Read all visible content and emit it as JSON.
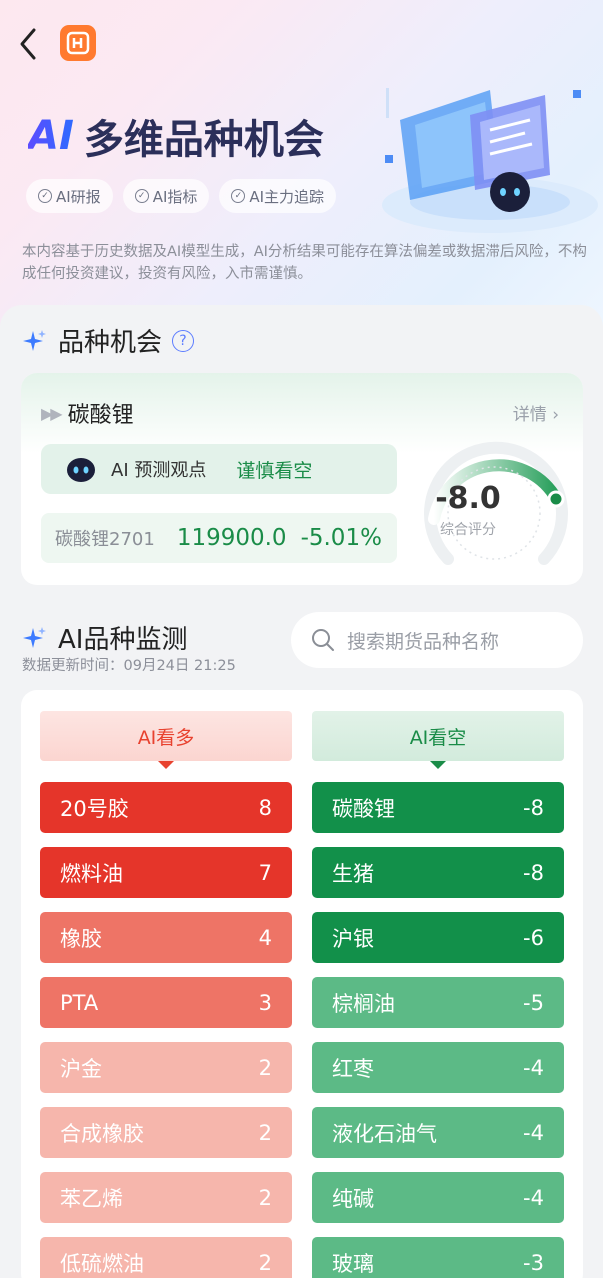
{
  "header": {
    "title_ai": "AI",
    "title_rest": "多维品种机会",
    "tags": [
      "AI研报",
      "AI指标",
      "AI主力追踪"
    ],
    "disclaimer": "本内容基于历史数据及AI模型生成，AI分析结果可能存在算法偏差或数据滞后风险，不构成任何投资建议，投资有风险，入市需谨慎。"
  },
  "opportunity": {
    "section_title": "品种机会",
    "name": "碳酸锂",
    "detail_label": "详情",
    "predict_label": "AI 预测观点",
    "predict_value": "谨慎看空",
    "contract": "碳酸锂2701",
    "price": "119900.0",
    "change": "-5.01%",
    "score": "-8.0",
    "score_label": "综合评分"
  },
  "monitor": {
    "section_title": "AI品种监测",
    "update_time": "数据更新时间：09月24日 21:25",
    "search_placeholder": "搜索期货品种名称",
    "bull_label": "AI看多",
    "bear_label": "AI看空",
    "bull_items": [
      {
        "name": "20号胶",
        "score": "8"
      },
      {
        "name": "燃料油",
        "score": "7"
      },
      {
        "name": "橡胶",
        "score": "4"
      },
      {
        "name": "PTA",
        "score": "3"
      },
      {
        "name": "沪金",
        "score": "2"
      },
      {
        "name": "合成橡胶",
        "score": "2"
      },
      {
        "name": "苯乙烯",
        "score": "2"
      },
      {
        "name": "低硫燃油",
        "score": "2"
      }
    ],
    "bear_items": [
      {
        "name": "碳酸锂",
        "score": "-8"
      },
      {
        "name": "生猪",
        "score": "-8"
      },
      {
        "name": "沪银",
        "score": "-6"
      },
      {
        "name": "棕榈油",
        "score": "-5"
      },
      {
        "name": "红枣",
        "score": "-4"
      },
      {
        "name": "液化石油气",
        "score": "-4"
      },
      {
        "name": "纯碱",
        "score": "-4"
      },
      {
        "name": "玻璃",
        "score": "-3"
      }
    ]
  },
  "colors": {
    "bull_strong": "#e5352a",
    "bull_mid": "#ee7466",
    "bull_weak": "#f6b6ac",
    "bear_strong": "#12904a",
    "bear_weak": "#5cba86"
  },
  "icons": [
    "back-arrow-icon",
    "app-logo-icon",
    "check-circle-icon",
    "sparkle-icon",
    "question-icon",
    "robot-icon",
    "search-icon",
    "chevron-right-icon"
  ]
}
